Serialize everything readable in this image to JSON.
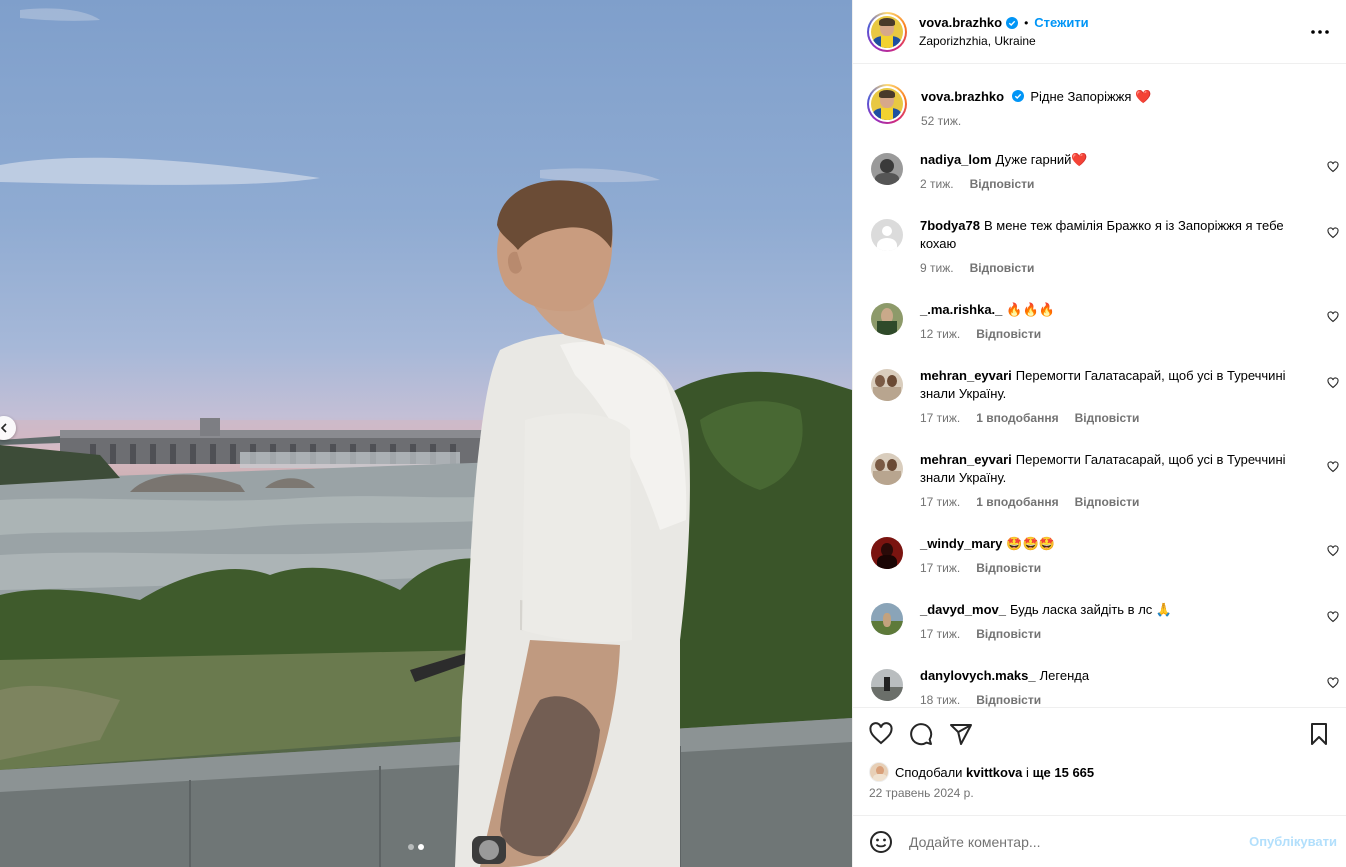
{
  "post": {
    "author": "vova.brazhko",
    "follow_label": "Стежити",
    "separator": "•",
    "location": "Zaporizhzhia, Ukraine",
    "caption_text": "Рідне Запоріжжя",
    "caption_emoji": "❤️",
    "caption_time": "52 тиж."
  },
  "comments": [
    {
      "user": "nadiya_lom",
      "text": "Дуже гарний❤️",
      "time": "2 тиж.",
      "likes": "",
      "reply": "Відповісти"
    },
    {
      "user": "7bodya78",
      "text": "В мене теж фамілія Бражко я із Запоріжжя я тебе кохаю",
      "time": "9 тиж.",
      "likes": "",
      "reply": "Відповісти"
    },
    {
      "user": "_.ma.rishka._",
      "text": "🔥🔥🔥",
      "time": "12 тиж.",
      "likes": "",
      "reply": "Відповісти"
    },
    {
      "user": "mehran_eyvari",
      "text": "Перемогти Галатасарай, щоб усі в Туреччині знали Україну.",
      "time": "17 тиж.",
      "likes": "1 вподобання",
      "reply": "Відповісти"
    },
    {
      "user": "mehran_eyvari",
      "text": "Перемогти Галатасарай, щоб усі в Туреччині знали Україну.",
      "time": "17 тиж.",
      "likes": "1 вподобання",
      "reply": "Відповісти"
    },
    {
      "user": "_windy_mary",
      "text": "🤩🤩🤩",
      "time": "17 тиж.",
      "likes": "",
      "reply": "Відповісти"
    },
    {
      "user": "_davyd_mov_",
      "text": "Будь ласка зайдіть в лс 🙏",
      "time": "17 тиж.",
      "likes": "",
      "reply": "Відповісти"
    },
    {
      "user": "danylovych.maks_",
      "text": "Легенда",
      "time": "18 тиж.",
      "likes": "",
      "reply": "Відповісти"
    }
  ],
  "likes": {
    "prefix": "Сподобали",
    "user": "kvittkova",
    "middle": "і",
    "rest": "ще 15 665"
  },
  "date": "22 травень 2024 р.",
  "add_comment": {
    "placeholder": "Додайте коментар...",
    "publish_label": "Опублікувати"
  },
  "icons": {
    "verified": "verified-badge-icon",
    "more": "more-options-icon",
    "heart": "heart-icon",
    "comment": "comment-icon",
    "share": "share-icon",
    "save": "bookmark-icon",
    "emoji": "emoji-icon",
    "prev": "chevron-left-icon"
  },
  "colors": {
    "accent": "#0095f6",
    "muted": "#737373",
    "publish_disabled": "#b2dffc"
  },
  "carousel": {
    "count": 2,
    "active": 2
  }
}
